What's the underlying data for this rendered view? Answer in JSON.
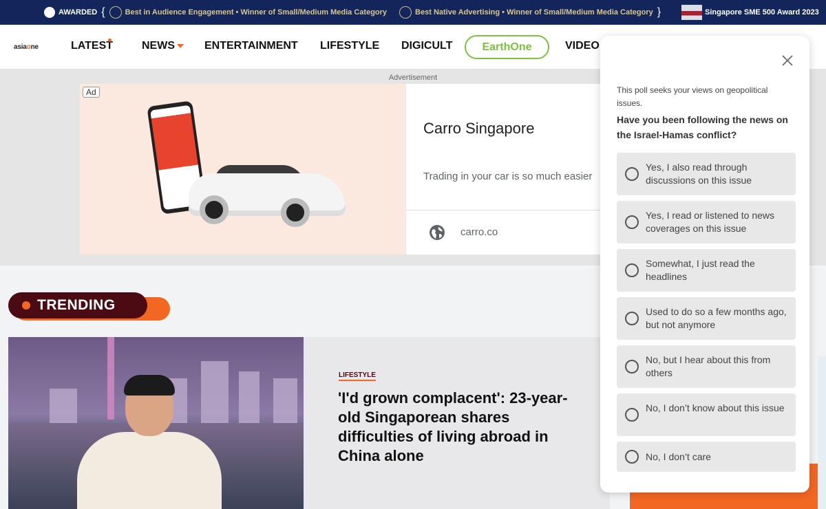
{
  "awards": {
    "awarded_label": "AWARDED",
    "award1": "Best in Audience Engagement • Winner of Small/Medium Media Category",
    "award2": "Best Native Advertising • Winner of Small/Medium Media Category",
    "award3": "Singapore SME 500 Award 2023",
    "brace_open": "{",
    "brace_close": "}"
  },
  "nav": {
    "logo": {
      "part1": "asia",
      "part2": "o",
      "part3": "ne"
    },
    "items": [
      "LATEST",
      "NEWS",
      "ENTERTAINMENT",
      "LIFESTYLE",
      "DIGICULT",
      "EarthOne",
      "VIDEO"
    ]
  },
  "ad": {
    "label": "Advertisement",
    "tag": "Ad",
    "title": "Carro Singapore",
    "description": "Trading in your car is so much easier",
    "url": "carro.co"
  },
  "trending": {
    "label": "TRENDING"
  },
  "article": {
    "category": "LIFESTYLE",
    "headline": "'I'd grown complacent': 23-year-old Singaporean shares difficulties of living abroad in China alone"
  },
  "poll": {
    "intro": "This poll seeks your views on geopolitical issues.",
    "question": "Have you been following the news on the Israel-Hamas conflict?",
    "options": [
      "Yes, I also read through discussions on this issue",
      "Yes, I read or listened to news coverages on this issue",
      "Somewhat, I just read the headlines",
      "Used to do so a few months ago, but not anymore",
      "No, but I hear about this from others",
      "No, I don’t know about this issue",
      "No, I don’t care"
    ]
  },
  "colors": {
    "awards_bg": "#13265c",
    "accent_orange": "#f26722",
    "earthone_green": "#7cbf41",
    "trending_dark": "#4a0b12"
  },
  "icons": [
    "close-icon",
    "globe-icon",
    "chevron-down-icon",
    "radio-icon"
  ]
}
